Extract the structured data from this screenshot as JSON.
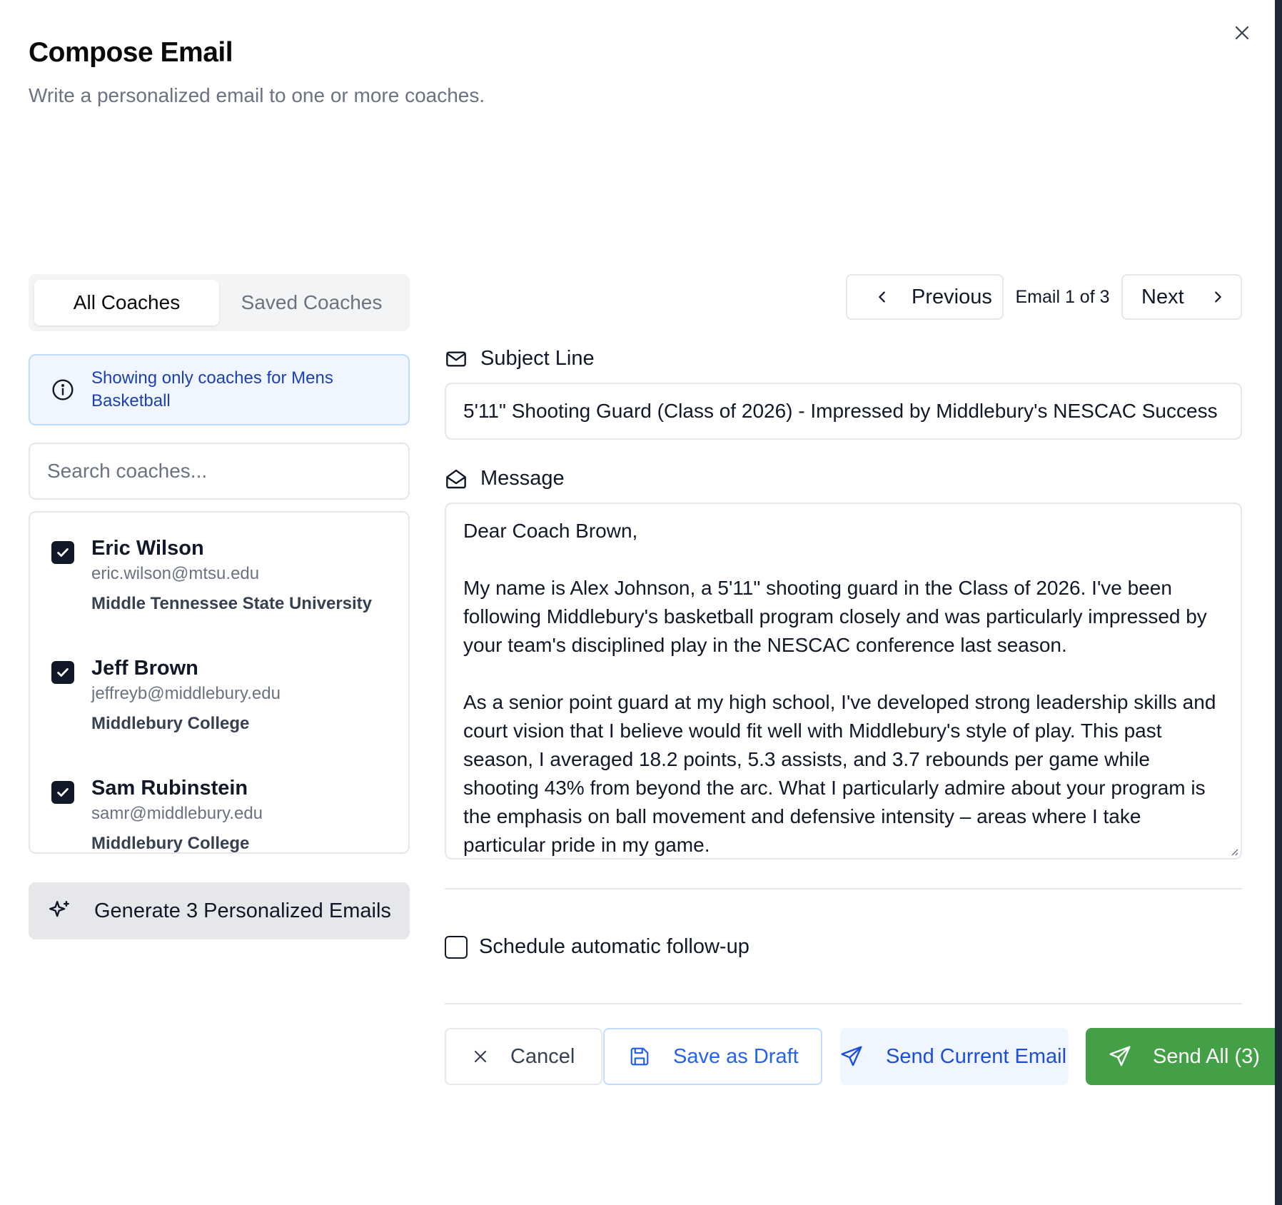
{
  "dialog": {
    "title": "Compose Email",
    "subtitle": "Write a personalized email to one or more coaches."
  },
  "tabs": [
    {
      "label": "All Coaches",
      "active": true
    },
    {
      "label": "Saved Coaches",
      "active": false
    }
  ],
  "info": {
    "text": "Showing only coaches for Mens Basketball"
  },
  "search": {
    "placeholder": "Search coaches...",
    "value": ""
  },
  "coaches": [
    {
      "name": "Eric Wilson",
      "email": "eric.wilson@mtsu.edu",
      "school": "Middle Tennessee State University",
      "checked": true
    },
    {
      "name": "Jeff Brown",
      "email": "jeffreyb@middlebury.edu",
      "school": "Middlebury College",
      "checked": true
    },
    {
      "name": "Sam Rubinstein",
      "email": "samr@middlebury.edu",
      "school": "Middlebury College",
      "checked": true
    }
  ],
  "generate_button": {
    "label": "Generate 3 Personalized Emails"
  },
  "pager": {
    "previous_label": "Previous",
    "count_text": "Email 1 of 3",
    "next_label": "Next"
  },
  "subject": {
    "label": "Subject Line",
    "value": "5'11\" Shooting Guard (Class of 2026) - Impressed by Middlebury's NESCAC Success"
  },
  "message": {
    "label": "Message",
    "value": "Dear Coach Brown,\n\nMy name is Alex Johnson, a 5'11\" shooting guard in the Class of 2026. I've been following Middlebury's basketball program closely and was particularly impressed by your team's disciplined play in the NESCAC conference last season.\n\nAs a senior point guard at my high school, I've developed strong leadership skills and court vision that I believe would fit well with Middlebury's style of play. This past season, I averaged 18.2 points, 5.3 assists, and 3.7 rebounds per game while shooting 43% from beyond the arc. What I particularly admire about your program is the emphasis on ball movement and defensive intensity – areas where I take particular pride in my game."
  },
  "follow_up": {
    "label": "Schedule automatic follow-up",
    "checked": false
  },
  "actions": {
    "cancel_label": "Cancel",
    "draft_label": "Save as Draft",
    "send_current_label": "Send Current Email",
    "send_all_label": "Send All (3)"
  },
  "colors": {
    "accent_blue": "#2563eb",
    "info_bg": "#eff6ff",
    "send_all_green": "#43a047",
    "checkbox_dark": "#111827"
  }
}
